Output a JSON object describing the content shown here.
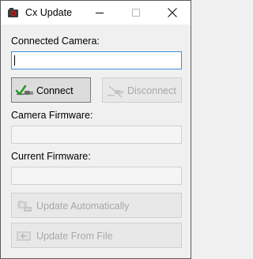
{
  "window": {
    "title": "Cx Update",
    "icon": "camera-icon"
  },
  "connected_camera": {
    "label": "Connected Camera:",
    "value": ""
  },
  "buttons": {
    "connect": {
      "label": "Connect",
      "icon": "connect-plug-icon",
      "enabled": true
    },
    "disconnect": {
      "label": "Disconnect",
      "icon": "disconnect-plug-icon",
      "enabled": false
    },
    "update_auto": {
      "label": "Update Automatically",
      "icon": "update-auto-icon",
      "enabled": false
    },
    "update_file": {
      "label": "Update From File",
      "icon": "update-file-icon",
      "enabled": false
    }
  },
  "camera_firmware": {
    "label": "Camera Firmware:",
    "value": ""
  },
  "current_firmware": {
    "label": "Current Firmware:",
    "value": ""
  },
  "colors": {
    "focus_border": "#3c8ede",
    "disabled_text": "#a8a8a8",
    "window_bg": "#f0f0f0"
  }
}
